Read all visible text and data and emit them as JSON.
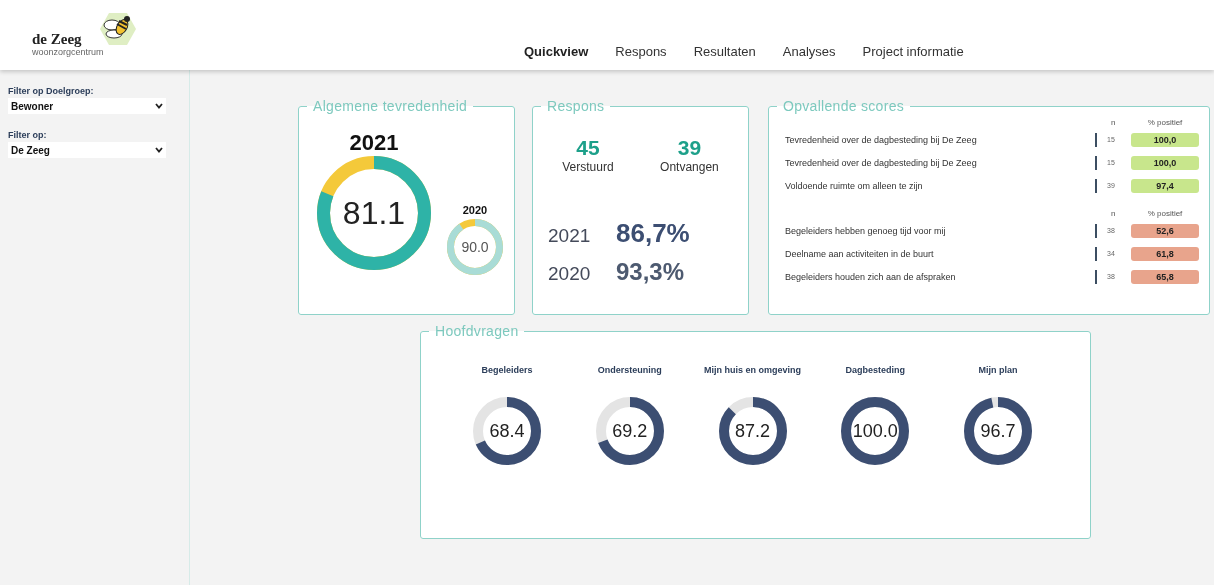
{
  "logo": {
    "name": "de Zeeg",
    "subtitle": "woonzorgcentrum"
  },
  "nav": [
    {
      "label": "Quickview",
      "selected": true
    },
    {
      "label": "Respons",
      "selected": false
    },
    {
      "label": "Resultaten",
      "selected": false
    },
    {
      "label": "Analyses",
      "selected": false
    },
    {
      "label": "Project informatie",
      "selected": false
    }
  ],
  "sidebar": {
    "filters": [
      {
        "label": "Filter op Doelgroep:",
        "value": "Bewoner"
      },
      {
        "label": "Filter op:",
        "value": "De Zeeg"
      }
    ]
  },
  "satisfaction": {
    "title": "Algemene tevredenheid",
    "current": {
      "year": "2021",
      "value": "81.1",
      "level": 0.811
    },
    "previous": {
      "year": "2020",
      "value": "90.0",
      "level": 0.9
    }
  },
  "response": {
    "title": "Respons",
    "counts": [
      {
        "value": "45",
        "label": "Verstuurd"
      },
      {
        "value": "39",
        "label": "Ontvangen"
      }
    ],
    "rates": [
      {
        "year": "2021",
        "value": "86,7%"
      },
      {
        "year": "2020",
        "value": "93,3%"
      }
    ]
  },
  "scores": {
    "title": "Opvallende scores",
    "groups": [
      {
        "n_header": "n",
        "pct_header": "% positief",
        "rows": [
          {
            "text": "Tevredenheid over de dagbesteding bij De Zeeg",
            "n": "15",
            "value": "100,0",
            "color": "#c8e68c"
          },
          {
            "text": "Tevredenheid over de dagbesteding bij De Zeeg",
            "n": "15",
            "value": "100,0",
            "color": "#c8e68c"
          },
          {
            "text": "Voldoende ruimte om alleen te zijn",
            "n": "39",
            "value": "97,4",
            "color": "#c8e68c"
          }
        ]
      },
      {
        "n_header": "n",
        "pct_header": "% positief",
        "rows": [
          {
            "text": "Begeleiders hebben genoeg tijd voor mij",
            "n": "38",
            "value": "52,6",
            "color": "#e8a48c"
          },
          {
            "text": "Deelname aan activiteiten in de buurt",
            "n": "34",
            "value": "61,8",
            "color": "#e8a48c"
          },
          {
            "text": "Begeleiders houden zich aan de afspraken",
            "n": "38",
            "value": "65,8",
            "color": "#e8a48c"
          }
        ]
      }
    ]
  },
  "main_questions": {
    "title": "Hoofdvragen",
    "items": [
      {
        "label": "Begeleiders",
        "value": "68.4",
        "level": 0.684
      },
      {
        "label": "Ondersteuning",
        "value": "69.2",
        "level": 0.692
      },
      {
        "label": "Mijn huis en omgeving",
        "value": "87.2",
        "level": 0.872
      },
      {
        "label": "Dagbesteding",
        "value": "100.0",
        "level": 1.0
      },
      {
        "label": "Mijn plan",
        "value": "96.7",
        "level": 0.967
      }
    ]
  }
}
